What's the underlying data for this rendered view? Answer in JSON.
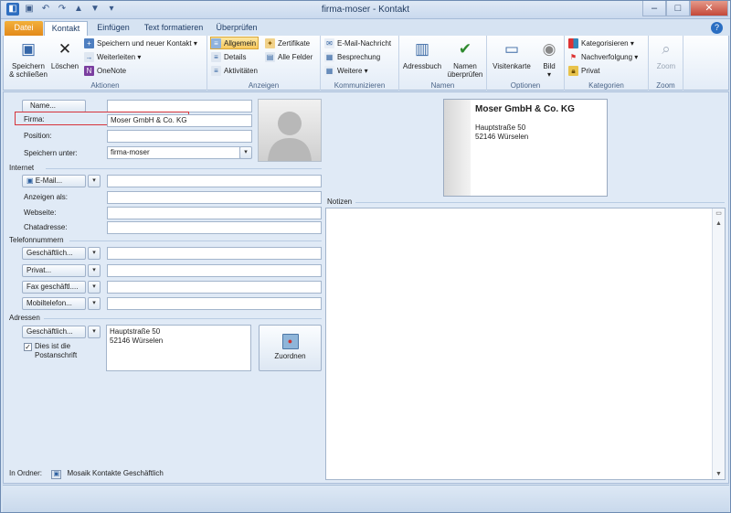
{
  "window": {
    "title": "firma-moser - Kontakt"
  },
  "tabs": [
    "Datei",
    "Kontakt",
    "Einfügen",
    "Text formatieren",
    "Überprüfen"
  ],
  "ribbon": {
    "aktionen": {
      "label": "Aktionen",
      "save_close": "Speichern & schließen",
      "delete": "Löschen",
      "save_new": "Speichern und neuer Kontakt",
      "forward": "Weiterleiten",
      "onenote": "OneNote"
    },
    "anzeigen": {
      "label": "Anzeigen",
      "general": "Allgemein",
      "details": "Details",
      "activities": "Aktivitäten",
      "certificates": "Zertifikate",
      "all_fields": "Alle Felder"
    },
    "kommunizieren": {
      "label": "Kommunizieren",
      "email": "E-Mail-Nachricht",
      "meeting": "Besprechung",
      "more": "Weitere"
    },
    "namen": {
      "label": "Namen",
      "address_book": "Adressbuch",
      "check_names": "Namen überprüfen"
    },
    "optionen": {
      "label": "Optionen",
      "business_card": "Visitenkarte",
      "picture": "Bild"
    },
    "kategorien": {
      "label": "Kategorien",
      "categorize": "Kategorisieren",
      "follow_up": "Nachverfolgung",
      "private": "Privat"
    },
    "zoom": {
      "label": "Zoom",
      "zoom": "Zoom"
    }
  },
  "form": {
    "name_button": "Name...",
    "name_value": "",
    "company_label": "Firma:",
    "company_value": "Moser GmbH & Co. KG",
    "position_label": "Position:",
    "position_value": "",
    "save_as_label": "Speichern unter:",
    "save_as_value": "firma-moser",
    "internet_section": "Internet",
    "email_button": "E-Mail...",
    "display_as_label": "Anzeigen als:",
    "website_label": "Webseite:",
    "chat_label": "Chatadresse:",
    "phone_section": "Telefonnummern",
    "phone_business": "Geschäftlich...",
    "phone_private": "Privat...",
    "phone_fax": "Fax geschäftl....",
    "phone_mobile": "Mobiltelefon...",
    "address_section": "Adressen",
    "address_type": "Geschäftlich...",
    "address_line1": "Hauptstraße 50",
    "address_line2": "52146 Würselen",
    "postal_checkbox_line1": "Dies ist die",
    "postal_checkbox_line2": "Postanschrift",
    "postal_checked": true,
    "map_button": "Zuordnen",
    "notes_label": "Notizen",
    "folder_label": "In Ordner:",
    "folder_value": "Mosaik Kontakte Geschäftlich"
  },
  "business_card": {
    "name": "Moser GmbH & Co. KG",
    "line1": "Hauptstraße 50",
    "line2": "52146 Würselen"
  }
}
